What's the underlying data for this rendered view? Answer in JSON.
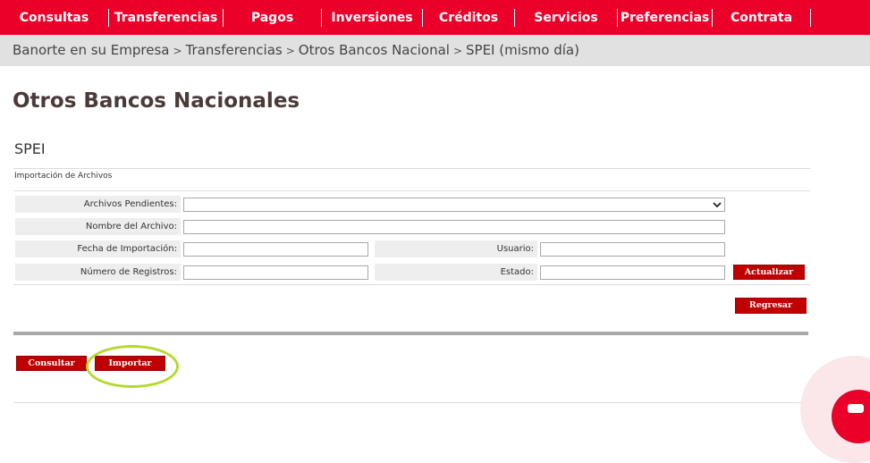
{
  "nav": {
    "items": [
      {
        "label": "Consultas"
      },
      {
        "label": "Transferencias"
      },
      {
        "label": "Pagos"
      },
      {
        "label": "Inversiones"
      },
      {
        "label": "Créditos"
      },
      {
        "label": "Servicios"
      },
      {
        "label": "Preferencias"
      },
      {
        "label": "Contrata"
      }
    ]
  },
  "breadcrumb": {
    "items": [
      "Banorte en su Empresa",
      "Transferencias",
      "Otros Bancos Nacional",
      "SPEI (mismo día)"
    ],
    "separator": ">"
  },
  "page": {
    "title": "Otros Bancos Nacionales",
    "section": "SPEI",
    "subsection": "Importación de Archivos"
  },
  "form": {
    "archivos_pendientes_label": "Archivos Pendientes:",
    "archivos_pendientes_value": "",
    "nombre_archivo_label": "Nombre del Archivo:",
    "nombre_archivo_value": "",
    "fecha_importacion_label": "Fecha de Importación:",
    "fecha_importacion_value": "",
    "usuario_label": "Usuario:",
    "usuario_value": "",
    "numero_registros_label": "Número de Registros:",
    "numero_registros_value": "",
    "estado_label": "Estado:",
    "estado_value": ""
  },
  "buttons": {
    "actualizar": "Actualizar",
    "regresar": "Regresar",
    "consultar": "Consultar",
    "importar": "Importar"
  },
  "colors": {
    "brand_red": "#eb0029",
    "button_red": "#c00000",
    "highlight": "#b5d92f"
  }
}
